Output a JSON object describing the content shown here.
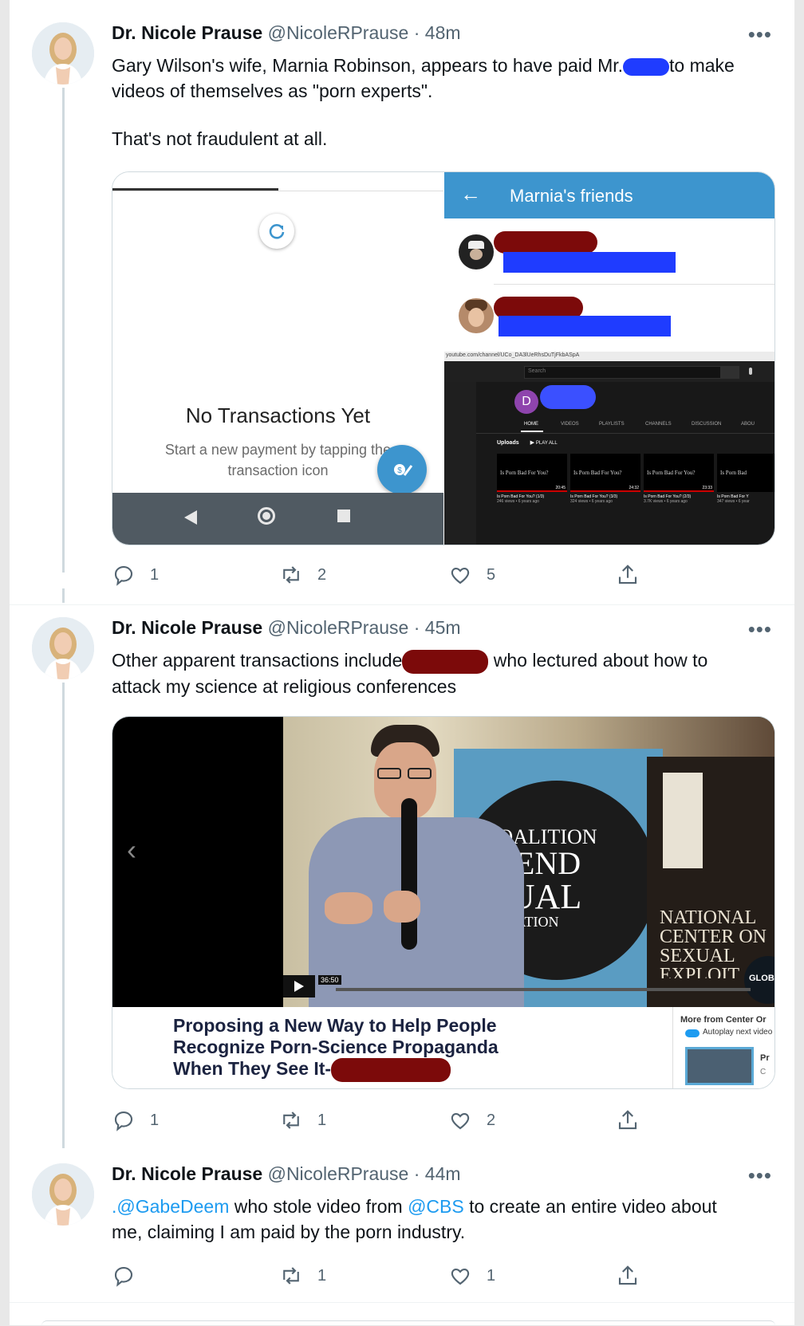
{
  "tweets": [
    {
      "name": "Dr. Nicole Prause",
      "handle": "@NicoleRPrause",
      "dot": "·",
      "time": "48m",
      "more": "•••",
      "text_line1_a": "Gary Wilson's wife, Marnia Robinson, appears to have paid Mr.",
      "text_line1_b": "to make",
      "text_line2": "videos of themselves as \"porn experts\".",
      "text_line3": "That's not fraudulent at all.",
      "reply_count": "1",
      "retweet_count": "2",
      "like_count": "5"
    },
    {
      "name": "Dr. Nicole Prause",
      "handle": "@NicoleRPrause",
      "dot": "·",
      "time": "45m",
      "more": "•••",
      "text_line1_a": "Other apparent transactions include",
      "text_line1_b": "who lectured about how to",
      "text_line2": "attack my science at religious conferences",
      "reply_count": "1",
      "retweet_count": "1",
      "like_count": "2"
    },
    {
      "name": "Dr. Nicole Prause",
      "handle": "@NicoleRPrause",
      "dot": "·",
      "time": "44m",
      "more": "•••",
      "mention1": ".@GabeDeem",
      "text_a": " who stole video from ",
      "mention2": "@CBS",
      "text_b": " to create an entire video about",
      "text_line2": "me, claiming I am paid by the porn industry.",
      "reply_count": "",
      "retweet_count": "1",
      "like_count": "1"
    }
  ],
  "venmo": {
    "empty_title": "No Transactions Yet",
    "empty_sub1": "Start a new payment by tapping the",
    "empty_sub2": "transaction icon"
  },
  "friends_panel": {
    "back": "←",
    "title": "Marnia's friends"
  },
  "youtube": {
    "url": "youtube.com/channel/UCo_DA3lUeRhsDuTjFkbASpA",
    "search": "Search",
    "avatar_letter": "D",
    "tabs": [
      "HOME",
      "VIDEOS",
      "PLAYLISTS",
      "CHANNELS",
      "DISCUSSION",
      "ABOU"
    ],
    "uploads": "Uploads",
    "play_all": "PLAY ALL",
    "videos": [
      {
        "thumb": "Is Porn Bad For You?",
        "duration": "20:45",
        "title": "Is Porn Bad For You? (1/3)",
        "meta": "246 views • 6 years ago"
      },
      {
        "thumb": "Is Porn Bad For You?",
        "duration": "24:32",
        "title": "Is Porn Bad For You? (3/3)",
        "meta": "324 views • 6 years ago"
      },
      {
        "thumb": "Is Porn Bad For You?",
        "duration": "23:33",
        "title": "Is Porn Bad For You? (2/3)",
        "meta": "3.7K views • 6 years ago"
      },
      {
        "thumb": "Is Porn Bad",
        "duration": "",
        "title": "Is Porn Bad For Y",
        "meta": "347 views • 6 year"
      }
    ]
  },
  "video_card": {
    "duration": "36:50",
    "banner1": "COALITION",
    "banner2": "O END",
    "banner3": "XUAL",
    "banner4": "LOITATION",
    "ncose1": "NATIONAL",
    "ncose2": "CENTER ON",
    "ncose3": "SEXUAL",
    "ncose4": "EXPLOIT",
    "glob": "GLOB",
    "title1": "Proposing a New Way to Help People",
    "title2": "Recognize Porn-Science Propaganda",
    "title3": "When They See It-",
    "more_from": "More from Center Or",
    "autoplay": "Autoplay next video",
    "side_initial": "Pr",
    "side_initial2": "C"
  },
  "colors": {
    "accent": "#1d9bf0",
    "venmo_blue": "#3d95ce",
    "redaction_red": "#7c0a0a",
    "redaction_blue": "#1f3cff"
  }
}
